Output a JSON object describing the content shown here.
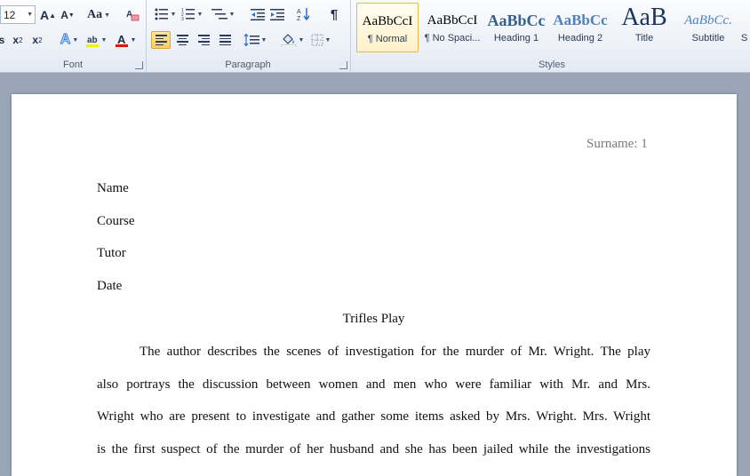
{
  "ribbon": {
    "font_group": {
      "label": "Font",
      "font_size": "12",
      "grow_font": "A",
      "shrink_font": "A",
      "change_case": "Aa",
      "subscript": "x",
      "superscript": "x"
    },
    "paragraph_group": {
      "label": "Paragraph",
      "show_marks": "¶"
    },
    "styles_group": {
      "label": "Styles",
      "tiles": [
        {
          "sample": "AaBbCcI",
          "name": "¶ Normal"
        },
        {
          "sample": "AaBbCcI",
          "name": "¶ No Spaci..."
        },
        {
          "sample": "AaBbCc",
          "name": "Heading 1"
        },
        {
          "sample": "AaBbCc",
          "name": "Heading 2"
        },
        {
          "sample": "AaB",
          "name": "Title"
        },
        {
          "sample": "AaBbCc.",
          "name": "Subtitle"
        },
        {
          "sample": "",
          "name": "S"
        }
      ]
    },
    "colors": {
      "highlight": "#f4f400",
      "font_color": "#e01010",
      "accent": "#f8cf68"
    }
  },
  "document": {
    "header": "Surname: 1",
    "lines": [
      "Name",
      "Course",
      "Tutor",
      "Date"
    ],
    "title": "Trifles Play",
    "paragraph_lines": [
      "The author describes the scenes of investigation for the murder of Mr. Wright. The play",
      "also portrays the discussion between women and men who were familiar with Mr. and Mrs.",
      "Wright who are present to investigate and gather some items asked by Mrs. Wright. Mrs. Wright",
      "is the first suspect of the murder of her husband and she has been jailed while the investigations"
    ]
  }
}
